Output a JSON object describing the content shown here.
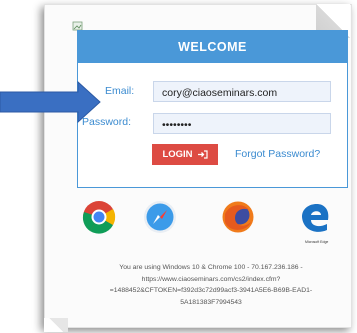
{
  "card": {
    "title": "WELCOME",
    "email_label": "Email:",
    "email_value": "cory@ciaoseminars.com",
    "password_label": "Password:",
    "password_value": "••••••••",
    "login_label": "LOGIN",
    "login_icon": "sign-in-icon",
    "forgot_label": "Forgot Password?"
  },
  "browsers": [
    {
      "name": "Chrome",
      "icon": "chrome-icon"
    },
    {
      "name": "Safari",
      "icon": "safari-icon"
    },
    {
      "name": "Firefox",
      "icon": "firefox-icon"
    },
    {
      "name": "Microsoft Edge",
      "icon": "edge-icon"
    }
  ],
  "edge_caption": "Microsoft Edge",
  "info_lines": [
    "You are using Windows 10 & Chrome 100 - 70.167.236.186 -",
    "https://www.ciaoseminars.com/cs2/index.cfm?",
    "=1488452&CFTOKEN=f392d3c72d99acf3-3941A5E6-B69B-EAD1-",
    "5A181383F7994543"
  ],
  "colors": {
    "header_bg": "#4a98d8",
    "label": "#3b8bd0",
    "login_bg": "#dd4b43",
    "arrow": "#3a6fc2"
  }
}
